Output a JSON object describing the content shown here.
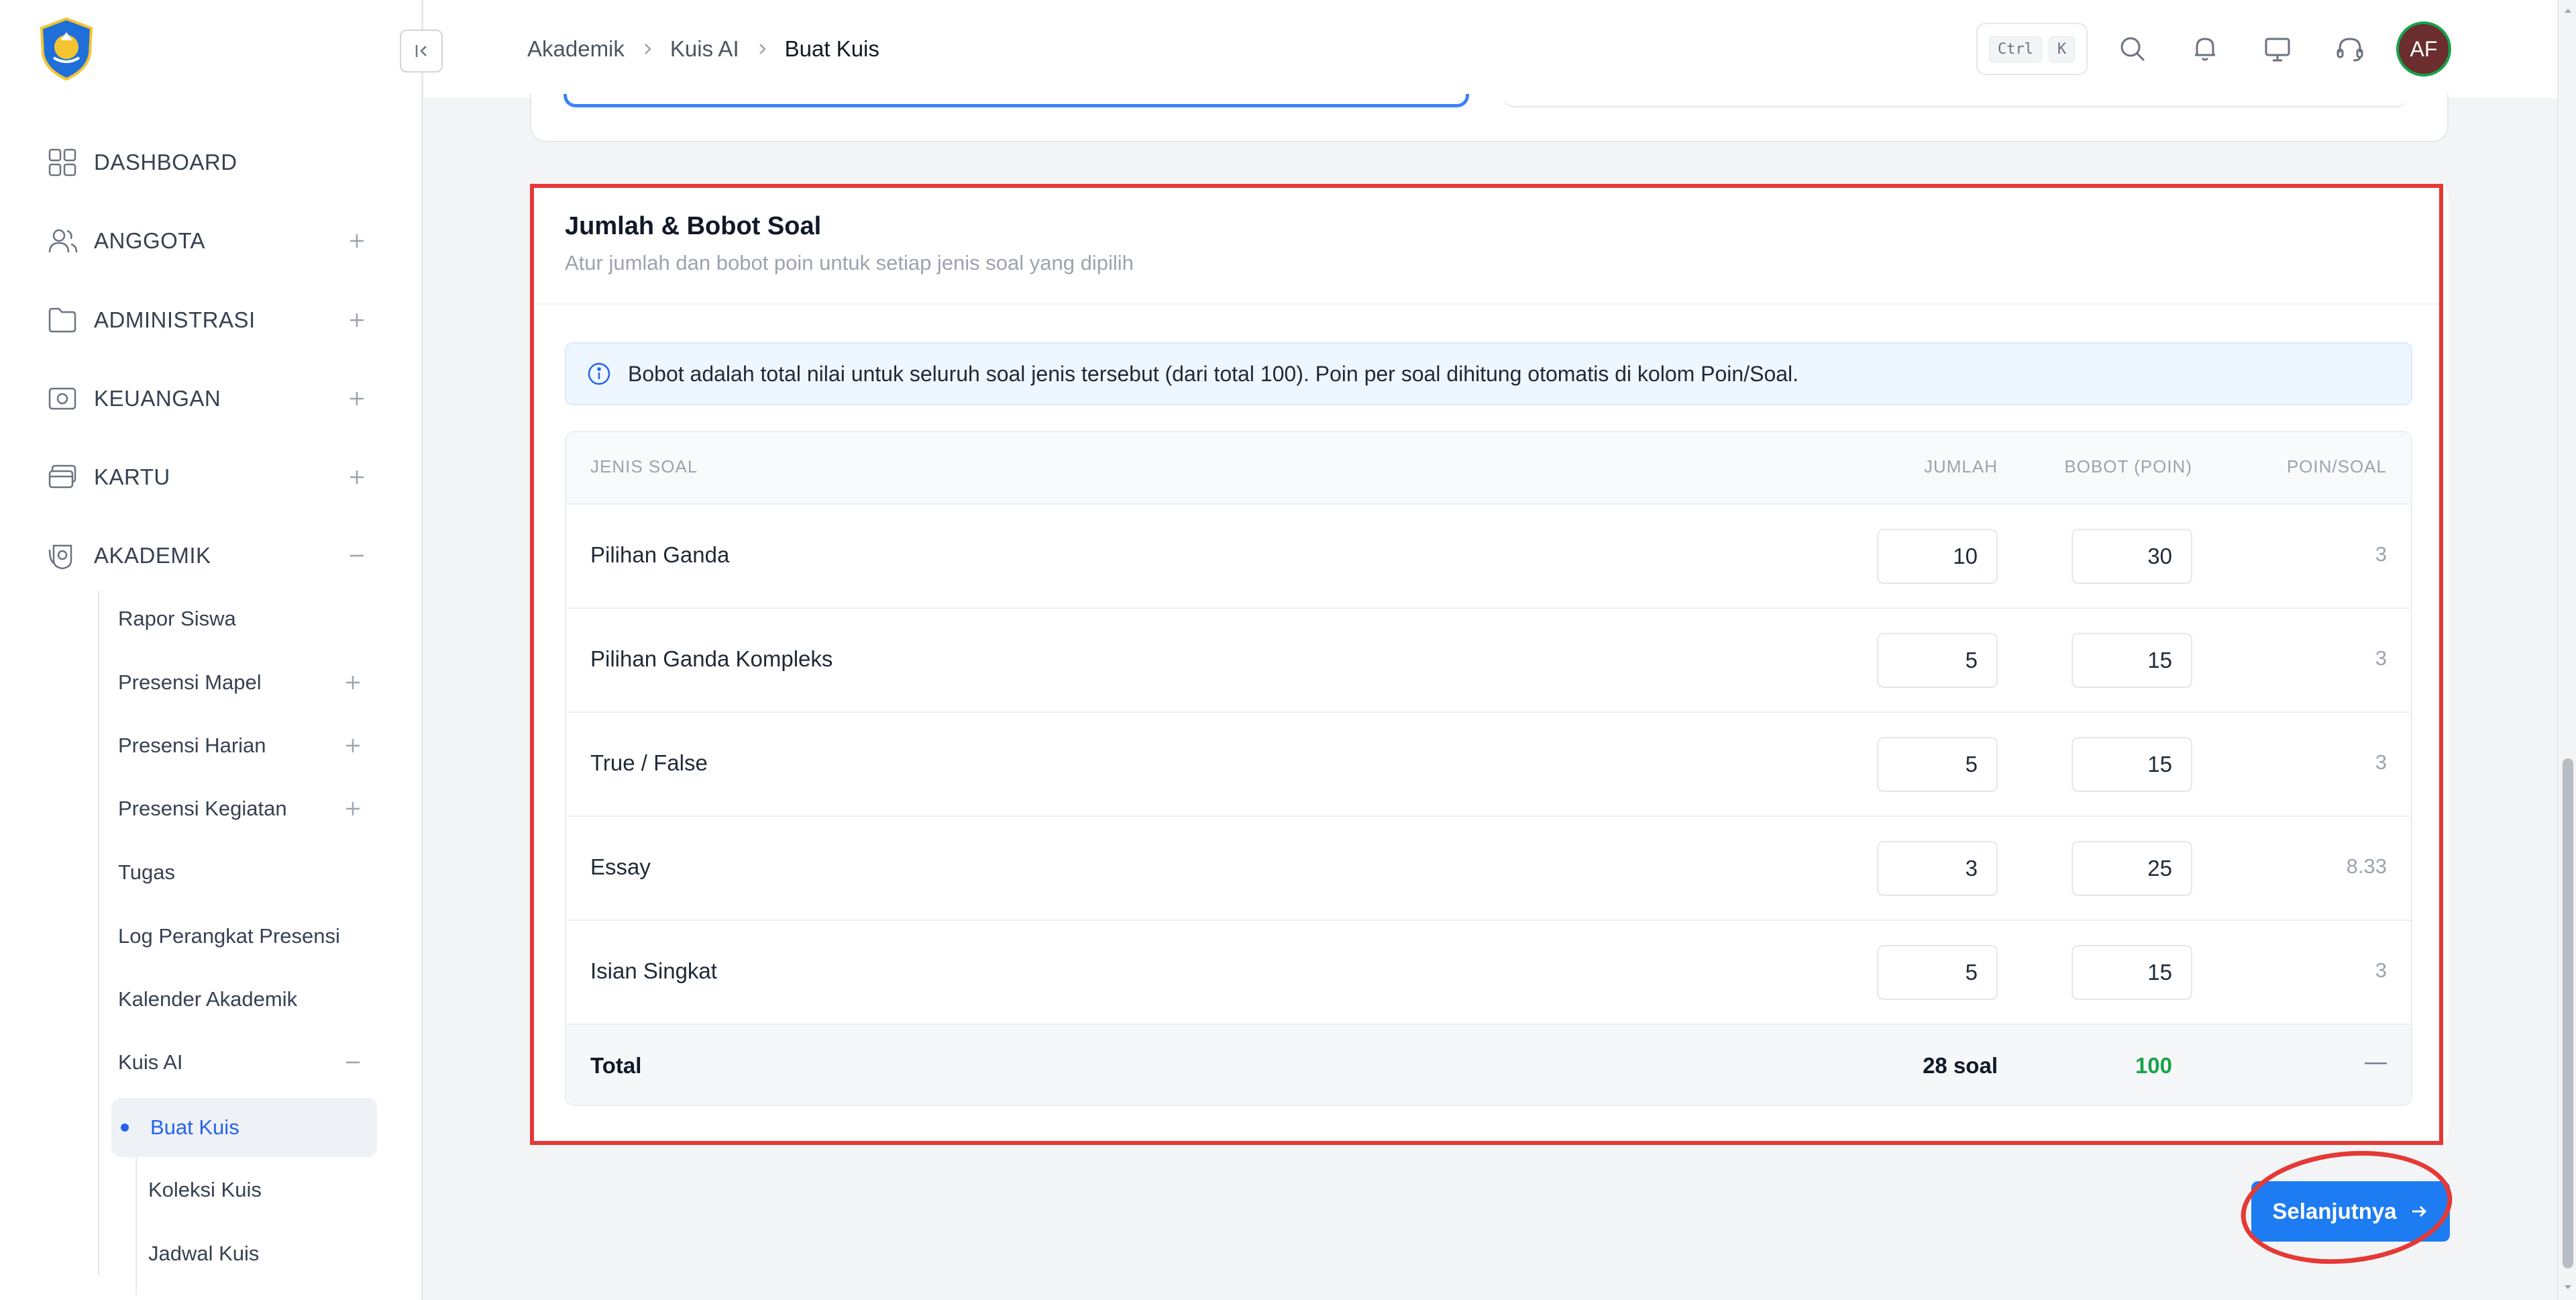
{
  "breadcrumb": {
    "level1": "Akademik",
    "level2": "Kuis AI",
    "level3": "Buat Kuis"
  },
  "header": {
    "shortcut": {
      "key1": "Ctrl",
      "key2": "K"
    },
    "avatar_initials": "AF",
    "icons": [
      "search-icon",
      "bell-icon",
      "monitor-icon",
      "headset-icon"
    ]
  },
  "sidebar": {
    "items": [
      {
        "label": "DASHBOARD",
        "icon": "grid-icon"
      },
      {
        "label": "ANGGOTA",
        "icon": "users-icon"
      },
      {
        "label": "ADMINISTRASI",
        "icon": "folder-icon"
      },
      {
        "label": "KEUANGAN",
        "icon": "camera-icon"
      },
      {
        "label": "KARTU",
        "icon": "cards-icon"
      },
      {
        "label": "AKADEMIK",
        "icon": "academic-icon"
      }
    ],
    "akademik_sub": [
      {
        "label": "Rapor Siswa"
      },
      {
        "label": "Presensi Mapel"
      },
      {
        "label": "Presensi Harian"
      },
      {
        "label": "Presensi Kegiatan"
      },
      {
        "label": "Tugas"
      },
      {
        "label": "Log Perangkat Presensi"
      },
      {
        "label": "Kalender Akademik"
      },
      {
        "label": "Kuis AI"
      }
    ],
    "kuis_sub": [
      {
        "label": "Buat Kuis"
      },
      {
        "label": "Koleksi Kuis"
      },
      {
        "label": "Jadwal Kuis"
      }
    ]
  },
  "card": {
    "title": "Jumlah & Bobot Soal",
    "subtitle": "Atur jumlah dan bobot poin untuk setiap jenis soal yang dipilih",
    "info": "Bobot adalah total nilai untuk seluruh soal jenis tersebut (dari total 100). Poin per soal dihitung otomatis di kolom Poin/Soal."
  },
  "table": {
    "headers": {
      "type": "JENIS SOAL",
      "count": "JUMLAH",
      "weight": "BOBOT (POIN)",
      "per": "POIN/SOAL"
    },
    "rows": [
      {
        "type": "Pilihan Ganda",
        "count": "10",
        "weight": "30",
        "per": "3"
      },
      {
        "type": "Pilihan Ganda Kompleks",
        "count": "5",
        "weight": "15",
        "per": "3"
      },
      {
        "type": "True / False",
        "count": "5",
        "weight": "15",
        "per": "3"
      },
      {
        "type": "Essay",
        "count": "3",
        "weight": "25",
        "per": "8.33"
      },
      {
        "type": "Isian Singkat",
        "count": "5",
        "weight": "15",
        "per": "3"
      }
    ],
    "total": {
      "label": "Total",
      "count": "28 soal",
      "weight": "100",
      "per": "—"
    }
  },
  "next_button": "Selanjutnya",
  "colors": {
    "accent": "#1d7cf2",
    "annotation": "#e53935",
    "success": "#16a34a"
  }
}
